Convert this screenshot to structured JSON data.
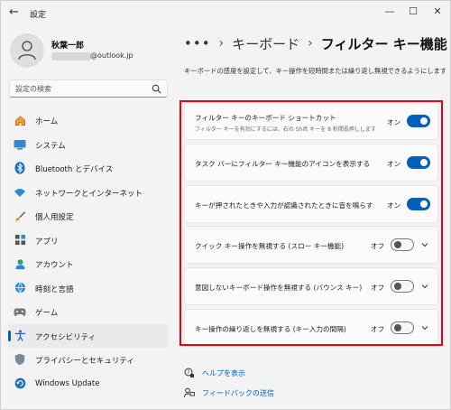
{
  "window": {
    "title": "設定",
    "controls": {
      "minimize": "—",
      "maximize": "☐",
      "close": "✕"
    }
  },
  "profile": {
    "name": "秋葉一郎",
    "email_suffix": "@outlook.jp"
  },
  "search": {
    "placeholder": "設定の検索"
  },
  "sidebar": {
    "items": [
      {
        "label": "ホーム",
        "icon": "home-icon"
      },
      {
        "label": "システム",
        "icon": "system-icon"
      },
      {
        "label": "Bluetooth とデバイス",
        "icon": "bluetooth-icon"
      },
      {
        "label": "ネットワークとインターネット",
        "icon": "network-icon"
      },
      {
        "label": "個人用設定",
        "icon": "brush-icon"
      },
      {
        "label": "アプリ",
        "icon": "apps-icon"
      },
      {
        "label": "アカウント",
        "icon": "account-icon"
      },
      {
        "label": "時刻と言語",
        "icon": "time-language-icon"
      },
      {
        "label": "ゲーム",
        "icon": "gaming-icon"
      },
      {
        "label": "アクセシビリティ",
        "icon": "accessibility-icon",
        "active": true
      },
      {
        "label": "プライバシーとセキュリティ",
        "icon": "shield-icon"
      },
      {
        "label": "Windows Update",
        "icon": "update-icon"
      }
    ]
  },
  "breadcrumb": {
    "dots": "•••",
    "parent": "キーボード",
    "current": "フィルター キー機能"
  },
  "description": "キーボードの感度を設定して、キー操作を短時間または繰り返し無視できるようにします。",
  "settings": [
    {
      "title": "フィルター キーのキーボード ショートカット",
      "subtitle": "フィルター キーを有効にするには、右の Shift キーを 8 秒間長押しします",
      "state_label": "オン",
      "on": true,
      "expandable": false
    },
    {
      "title": "タスク バーにフィルター キー機能のアイコンを表示する",
      "state_label": "オン",
      "on": true,
      "expandable": false
    },
    {
      "title": "キーが押されたときや入力が認識されたときに音を鳴らす",
      "state_label": "オン",
      "on": true,
      "expandable": false
    },
    {
      "title": "クイック キー操作を無視する (スロー キー機能)",
      "state_label": "オフ",
      "on": false,
      "expandable": true
    },
    {
      "title": "意図しないキーボード操作を無視する (バウンス キー)",
      "state_label": "オフ",
      "on": false,
      "expandable": true
    },
    {
      "title": "キー操作の繰り返しを無視する (キー入力の間隔)",
      "state_label": "オフ",
      "on": false,
      "expandable": true
    }
  ],
  "links": {
    "help": "ヘルプを表示",
    "feedback": "フィードバックの送信"
  },
  "colors": {
    "accent": "#005fb8",
    "highlight_border": "#e60012",
    "background": "#f3f3f3",
    "card": "#fbfbfb"
  }
}
